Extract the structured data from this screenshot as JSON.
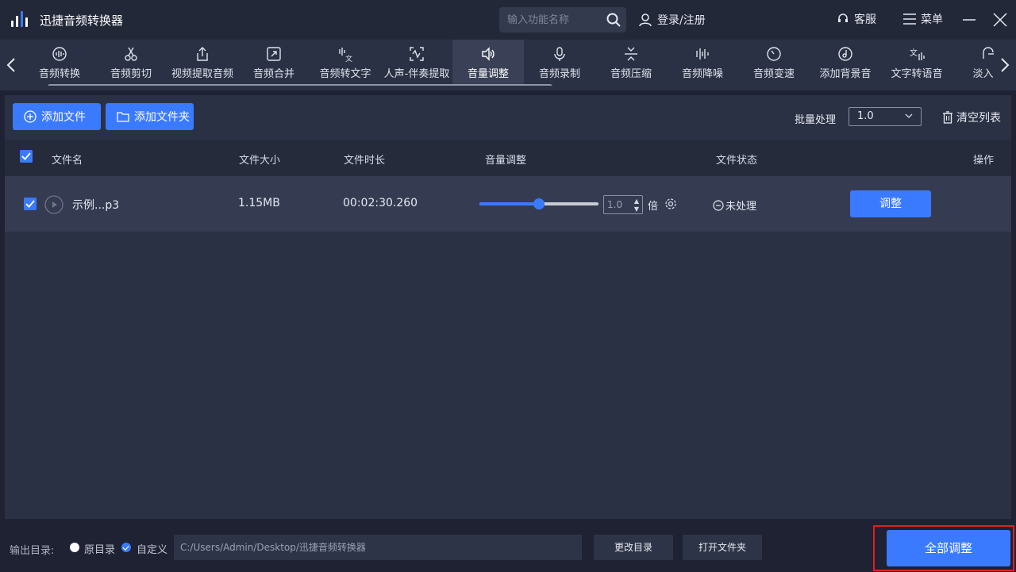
{
  "app": {
    "title": "迅捷音频转换器"
  },
  "header": {
    "search_placeholder": "输入功能名称",
    "login": "登录/注册",
    "service": "客服",
    "menu": "菜单"
  },
  "tools": [
    {
      "label": "音频转换",
      "icon": "waveform-circle-icon"
    },
    {
      "label": "音频剪切",
      "icon": "scissors-icon"
    },
    {
      "label": "视频提取音频",
      "icon": "export-icon"
    },
    {
      "label": "音频合并",
      "icon": "merge-icon"
    },
    {
      "label": "音频转文字",
      "icon": "audio-to-text-icon"
    },
    {
      "label": "人声-伴奏提取",
      "icon": "vocal-extract-icon"
    },
    {
      "label": "音量调整",
      "icon": "speaker-icon",
      "active": true
    },
    {
      "label": "音频录制",
      "icon": "microphone-icon"
    },
    {
      "label": "音频压缩",
      "icon": "compress-icon"
    },
    {
      "label": "音频降噪",
      "icon": "noise-reduce-icon"
    },
    {
      "label": "音频变速",
      "icon": "speed-icon"
    },
    {
      "label": "添加背景音",
      "icon": "music-disc-icon"
    },
    {
      "label": "文字转语音",
      "icon": "text-to-speech-icon"
    },
    {
      "label": "淡入淡",
      "icon": "fade-icon"
    }
  ],
  "actions": {
    "add_file": "添加文件",
    "add_folder": "添加文件夹",
    "batch_label": "批量处理",
    "batch_value": "1.0",
    "clear_list": "清空列表"
  },
  "table": {
    "headers": [
      "文件名",
      "文件大小",
      "文件时长",
      "音量调整",
      "文件状态",
      "操作"
    ],
    "rows": [
      {
        "name": "示例...p3",
        "size": "1.15MB",
        "duration": "00:02:30.260",
        "volume_value": "1.0",
        "volume_level": 0.5,
        "times": "倍",
        "status": "未处理",
        "action": "调整"
      }
    ]
  },
  "footer": {
    "output_label": "输出目录:",
    "option_original": "原目录",
    "option_custom": "自定义",
    "path": "C:/Users/Admin/Desktop/迅捷音频转换器",
    "change_dir": "更改目录",
    "open_folder": "打开文件夹",
    "all_adjust": "全部调整"
  },
  "colors": {
    "accent": "#3a7afe",
    "highlight": "#e02020"
  }
}
